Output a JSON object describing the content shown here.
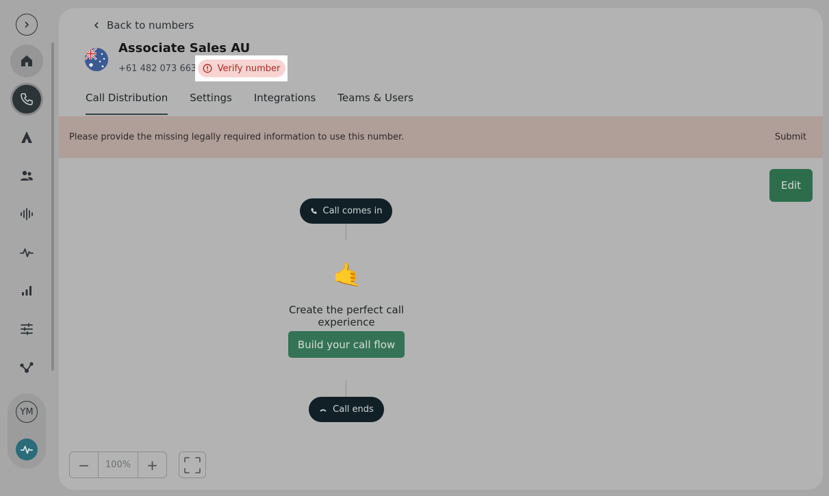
{
  "sidebar": {
    "icons": [
      "home-icon",
      "phone-icon",
      "aircall-ai-icon",
      "contacts-icon",
      "voice-icon",
      "activity-icon",
      "analytics-icon",
      "settings-sliders-icon",
      "integrations-icon"
    ],
    "avatar_initials": "YM"
  },
  "header": {
    "back_label": "Back to numbers",
    "title": "Associate Sales AU",
    "phone": "+61 482 073 663",
    "verify_label": "Verify number"
  },
  "tabs": [
    {
      "label": "Call Distribution",
      "active": true
    },
    {
      "label": "Settings",
      "active": false
    },
    {
      "label": "Integrations",
      "active": false
    },
    {
      "label": "Teams & Users",
      "active": false
    }
  ],
  "banner": {
    "message": "Please provide the missing legally required information to use this number.",
    "submit_label": "Submit"
  },
  "flow": {
    "edit_label": "Edit",
    "start_label": "Call comes in",
    "emoji": "🤙",
    "cta_text": "Create the perfect call experience",
    "build_label": "Build your call flow",
    "end_label": "Call ends"
  },
  "zoom": {
    "minus": "−",
    "value": "100%",
    "plus": "+"
  },
  "colors": {
    "accent_green": "#347356",
    "dark_pill": "#102026",
    "banner": "#b09e99",
    "verify_red": "#b3261e"
  }
}
